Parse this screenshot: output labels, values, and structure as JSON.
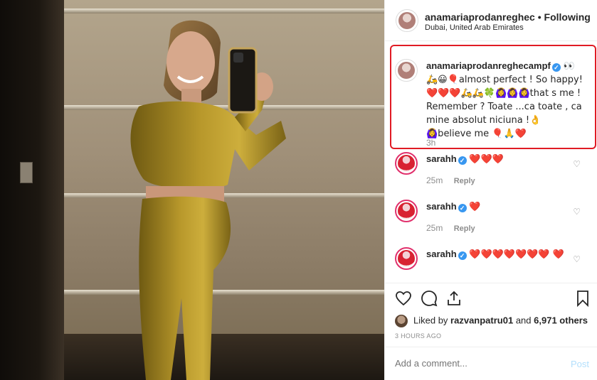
{
  "post": {
    "username": "anamariaprodanreghec",
    "separator": "•",
    "follow_label": "Following",
    "location": "Dubai, United Arab Emirates"
  },
  "caption": {
    "username": "anamariaprodanreghecampf",
    "text": "👀 🛵😀🎈almost perfect ! So happy! ❤️❤️❤️🛵🛵🍀🙆‍♀️🙆‍♀️🙆‍♀️that s me ! Remember ? Toate ...ca toate , ca mine absolut niciuna !👌🙆‍♀️believe me 🎈🙏❤️",
    "time": "3h"
  },
  "comments": [
    {
      "username": "sarahh",
      "text": "❤️❤️❤️",
      "time": "25m",
      "reply_label": "Reply"
    },
    {
      "username": "sarahh",
      "text": "❤️",
      "time": "25m",
      "reply_label": "Reply"
    },
    {
      "username": "sarahh",
      "text": "❤️❤️❤️❤️❤️❤️❤️ ❤️",
      "time": "",
      "reply_label": ""
    }
  ],
  "likes": {
    "prefix": "Liked by",
    "user": "razvanpatru01",
    "middle": "and",
    "count": "6,971 others"
  },
  "timestamp": "3 HOURS AGO",
  "add_comment": {
    "placeholder": "Add a comment...",
    "post_label": "Post"
  },
  "colors": {
    "highlight": "#e01b24",
    "verified": "#3897f0",
    "heart": "#ed4956",
    "post_disabled": "#b2dffc"
  },
  "icons": [
    "heart-icon",
    "comment-icon",
    "share-icon",
    "bookmark-icon",
    "verified-icon"
  ]
}
